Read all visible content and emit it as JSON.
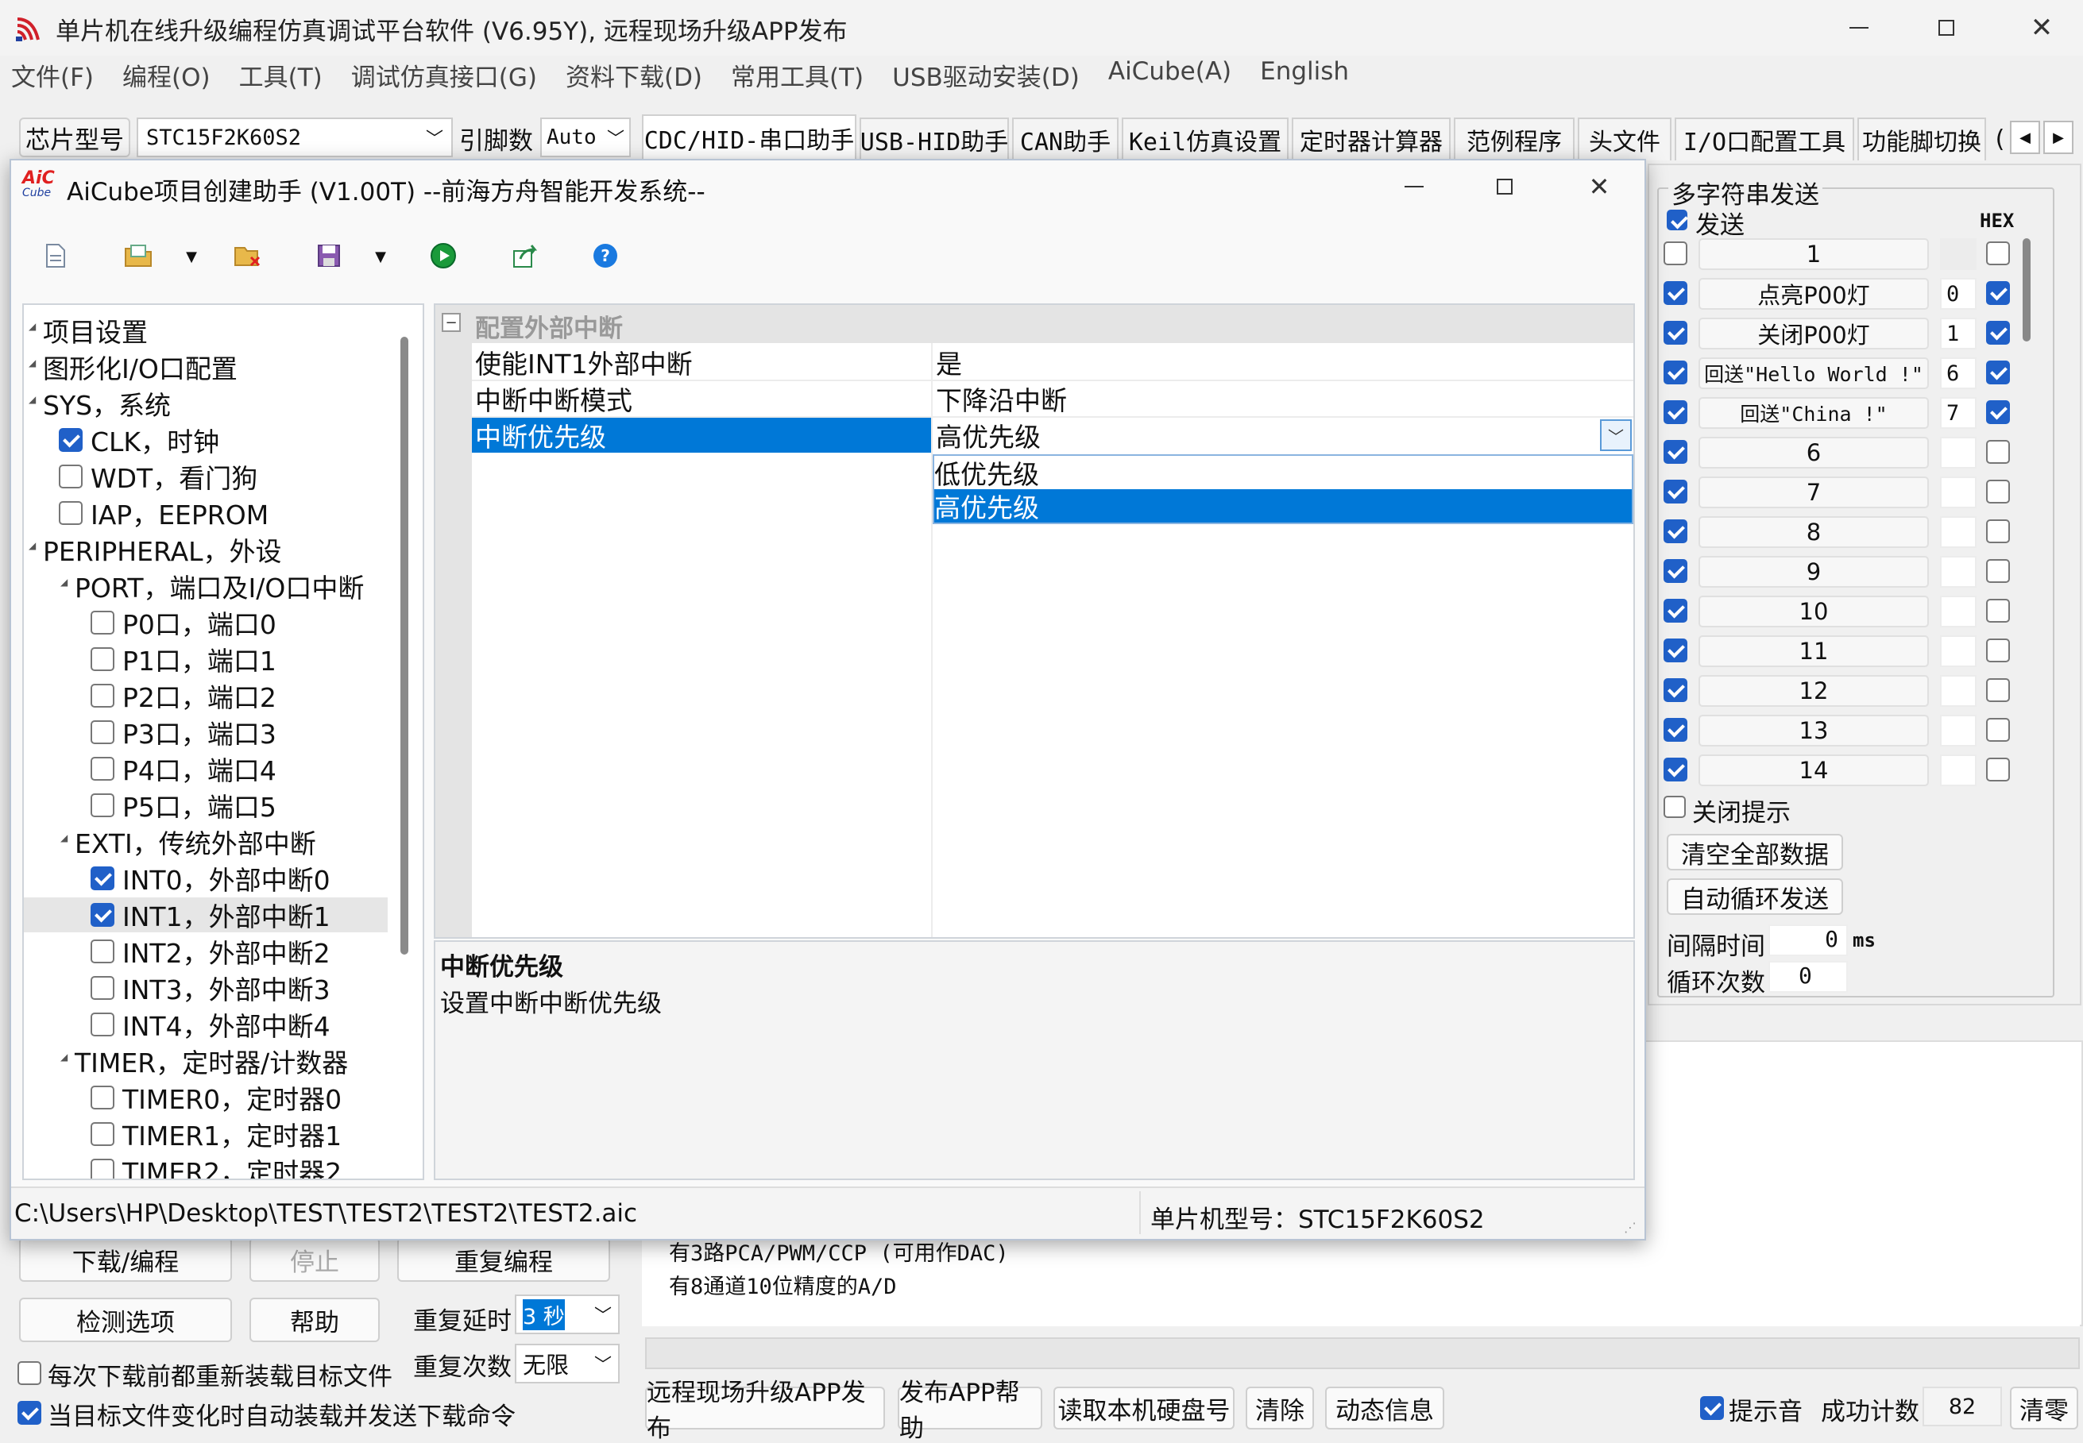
{
  "main_window": {
    "title": "单片机在线升级编程仿真调试平台软件 (V6.95Y), 远程现场升级APP发布",
    "menu": [
      "文件(F)",
      "编程(O)",
      "工具(T)",
      "调试仿真接口(G)",
      "资料下载(D)",
      "常用工具(T)",
      "USB驱动安装(D)",
      "AiCube(A)",
      "English"
    ],
    "chip_label": "芯片型号",
    "chip_value": "STC15F2K60S2",
    "pin_label": "引脚数",
    "pin_value": "Auto",
    "tabs": [
      "CDC/HID-串口助手",
      "USB-HID助手",
      "CAN助手",
      "Keil仿真设置",
      "定时器计算器",
      "范例程序",
      "头文件",
      "I/O口配置工具",
      "功能脚切换",
      "("
    ]
  },
  "multi_send": {
    "title": "多字符串发送",
    "send_label": "发送",
    "hex_label": "HEX",
    "rows": [
      {
        "checked": false,
        "text": "1",
        "hex": "",
        "hex_checked": false
      },
      {
        "checked": true,
        "text": "点亮P00灯",
        "hex": "0",
        "hex_checked": true
      },
      {
        "checked": true,
        "text": "关闭P00灯",
        "hex": "1",
        "hex_checked": true
      },
      {
        "checked": true,
        "text": "回送\"Hello World !\"",
        "hex": "6",
        "hex_checked": true
      },
      {
        "checked": true,
        "text": "回送\"China !\"",
        "hex": "7",
        "hex_checked": true
      },
      {
        "checked": true,
        "text": "6",
        "hex": "",
        "hex_checked": false
      },
      {
        "checked": true,
        "text": "7",
        "hex": "",
        "hex_checked": false
      },
      {
        "checked": true,
        "text": "8",
        "hex": "",
        "hex_checked": false
      },
      {
        "checked": true,
        "text": "9",
        "hex": "",
        "hex_checked": false
      },
      {
        "checked": true,
        "text": "10",
        "hex": "",
        "hex_checked": false
      },
      {
        "checked": true,
        "text": "11",
        "hex": "",
        "hex_checked": false
      },
      {
        "checked": true,
        "text": "12",
        "hex": "",
        "hex_checked": false
      },
      {
        "checked": true,
        "text": "13",
        "hex": "",
        "hex_checked": false
      },
      {
        "checked": true,
        "text": "14",
        "hex": "",
        "hex_checked": false
      }
    ],
    "close_tip": "关闭提示",
    "clear_all": "清空全部数据",
    "auto_loop": "自动循环发送",
    "interval_label": "间隔时间",
    "interval_value": "0",
    "interval_unit": "ms",
    "loop_label": "循环次数",
    "loop_value": "0"
  },
  "bottom": {
    "download": "下载/编程",
    "stop": "停止",
    "reprogram": "重复编程",
    "check_options": "检测选项",
    "help": "帮助",
    "repeat_delay_label": "重复延时",
    "repeat_delay_value": "3 秒",
    "repeat_count_label": "重复次数",
    "repeat_count_value": "无限",
    "reload_each": "每次下载前都重新装载目标文件",
    "auto_reload": "当目标文件变化时自动装载并发送下载命令",
    "log_lines": [
      "有3路PCA/PWM/CCP (可用作DAC)",
      "有8通道10位精度的A/D"
    ],
    "remote_upgrade": "远程现场升级APP发布",
    "publish_help": "发布APP帮助",
    "read_disk": "读取本机硬盘号",
    "clear": "清除",
    "dynamic_info": "动态信息",
    "prompt_sound": "提示音",
    "success_count_label": "成功计数",
    "success_count": "82",
    "reset": "清零"
  },
  "dialog": {
    "logo": "AiC",
    "logo_sub": "Cube",
    "title": "AiCube项目创建助手 (V1.00T) --前海方舟智能开发系统--",
    "tree": [
      {
        "label": "项目设置",
        "level": 0,
        "check": null
      },
      {
        "label": "图形化I/O口配置",
        "level": 0,
        "check": null
      },
      {
        "label": "SYS，系统",
        "level": 0,
        "check": null
      },
      {
        "label": "CLK，时钟",
        "level": 1,
        "check": true
      },
      {
        "label": "WDT，看门狗",
        "level": 1,
        "check": false
      },
      {
        "label": "IAP，EEPROM",
        "level": 1,
        "check": false
      },
      {
        "label": "PERIPHERAL，外设",
        "level": 0,
        "check": null
      },
      {
        "label": "PORT，端口及I/O口中断",
        "level": 1,
        "check": null
      },
      {
        "label": "P0口，端口0",
        "level": 2,
        "check": false
      },
      {
        "label": "P1口，端口1",
        "level": 2,
        "check": false
      },
      {
        "label": "P2口，端口2",
        "level": 2,
        "check": false
      },
      {
        "label": "P3口，端口3",
        "level": 2,
        "check": false
      },
      {
        "label": "P4口，端口4",
        "level": 2,
        "check": false
      },
      {
        "label": "P5口，端口5",
        "level": 2,
        "check": false
      },
      {
        "label": "EXTI，传统外部中断",
        "level": 1,
        "check": null
      },
      {
        "label": "INT0，外部中断0",
        "level": 2,
        "check": true
      },
      {
        "label": "INT1，外部中断1",
        "level": 2,
        "check": true,
        "selected": true
      },
      {
        "label": "INT2，外部中断2",
        "level": 2,
        "check": false
      },
      {
        "label": "INT3，外部中断3",
        "level": 2,
        "check": false
      },
      {
        "label": "INT4，外部中断4",
        "level": 2,
        "check": false
      },
      {
        "label": "TIMER，定时器/计数器",
        "level": 1,
        "check": null
      },
      {
        "label": "TIMER0，定时器0",
        "level": 2,
        "check": false
      },
      {
        "label": "TIMER1，定时器1",
        "level": 2,
        "check": false
      },
      {
        "label": "TIMER2，定时器2",
        "level": 2,
        "check": false
      }
    ],
    "group_title": "配置外部中断",
    "properties": [
      {
        "name": "使能INT1外部中断",
        "value": "是"
      },
      {
        "name": "中断中断模式",
        "value": "下降沿中断"
      },
      {
        "name": "中断优先级",
        "value": "高优先级"
      }
    ],
    "dropdown_options": [
      "低优先级",
      "高优先级"
    ],
    "desc_title": "中断优先级",
    "desc_text": "设置中断中断优先级",
    "status_path": "C:\\Users\\HP\\Desktop\\TEST\\TEST2\\TEST2\\TEST2.aic",
    "status_chip": "单片机型号：STC15F2K60S2"
  },
  "colors": {
    "accent": "#0078d7",
    "check": "#2060c8",
    "logo_red": "#e02020"
  }
}
